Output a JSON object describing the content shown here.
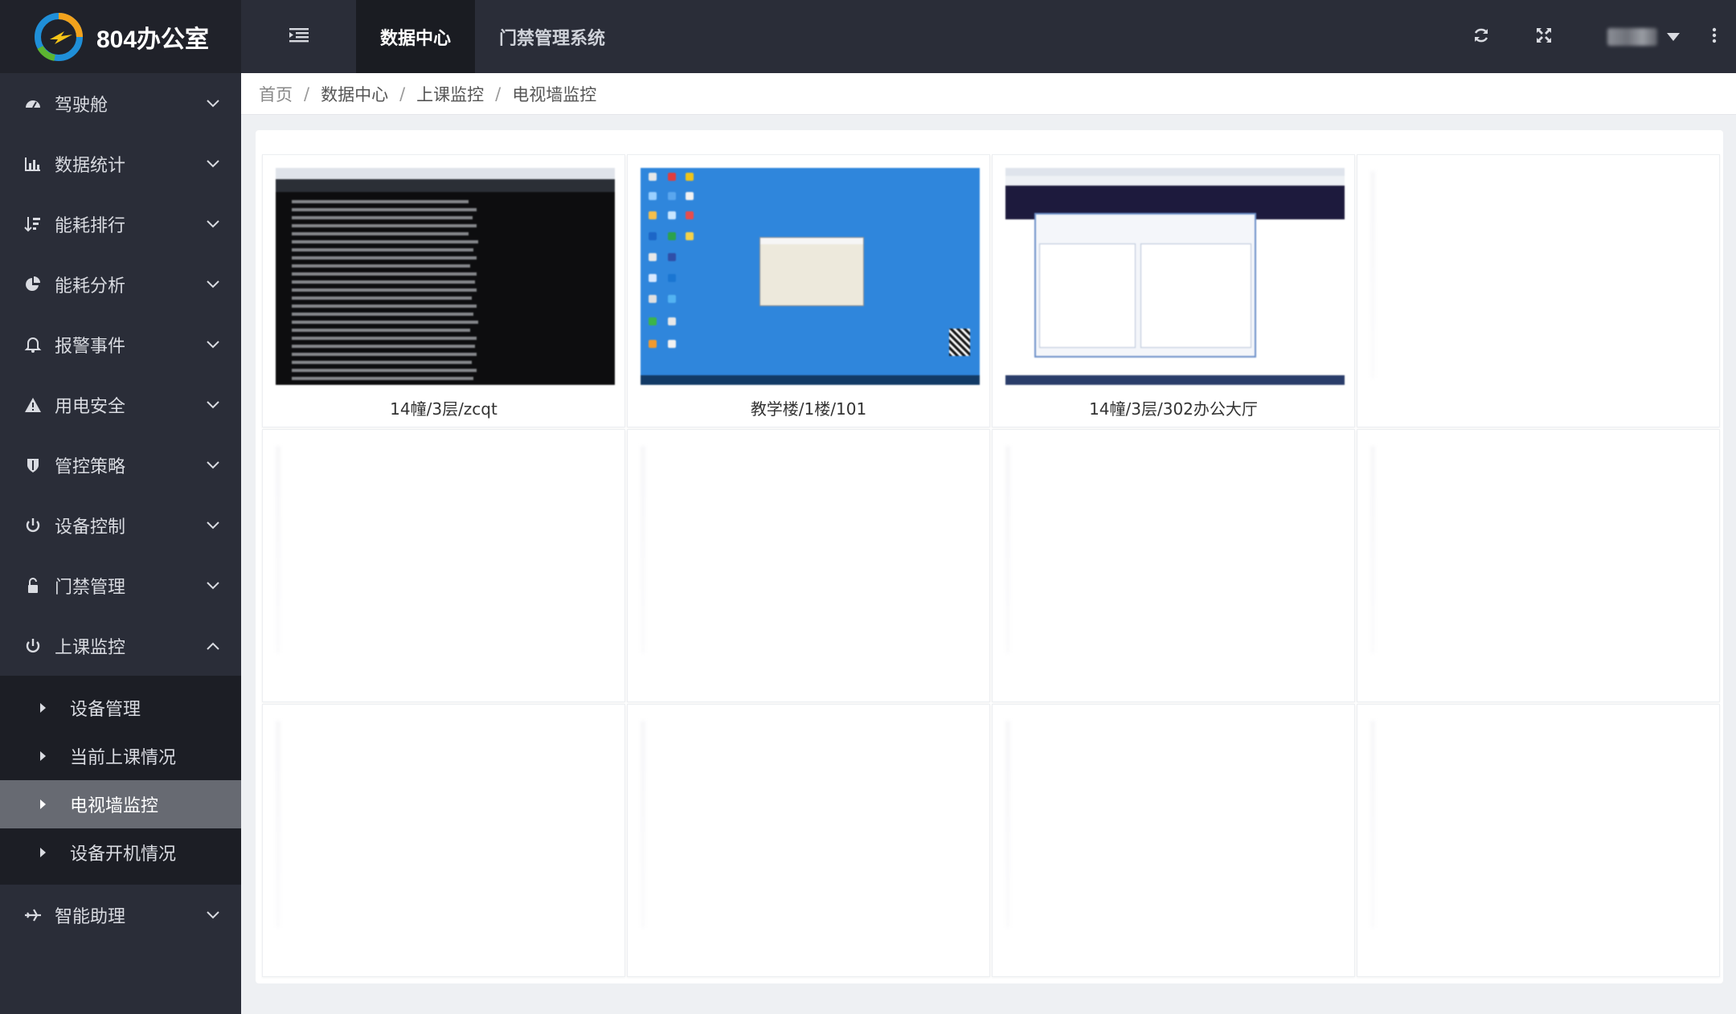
{
  "app": {
    "title": "804办公室"
  },
  "topbar": {
    "tabs": [
      {
        "label": "数据中心",
        "active": true
      },
      {
        "label": "门禁管理系统",
        "active": false
      }
    ]
  },
  "sidebar": {
    "items": [
      {
        "label": "驾驶舱",
        "icon": "dashboard-icon",
        "expanded": false
      },
      {
        "label": "数据统计",
        "icon": "bar-chart-icon",
        "expanded": false
      },
      {
        "label": "能耗排行",
        "icon": "sort-amount-icon",
        "expanded": false
      },
      {
        "label": "能耗分析",
        "icon": "pie-chart-icon",
        "expanded": false
      },
      {
        "label": "报警事件",
        "icon": "bell-icon",
        "expanded": false
      },
      {
        "label": "用电安全",
        "icon": "warning-icon",
        "expanded": false
      },
      {
        "label": "管控策略",
        "icon": "shield-icon",
        "expanded": false
      },
      {
        "label": "设备控制",
        "icon": "power-icon",
        "expanded": false
      },
      {
        "label": "门禁管理",
        "icon": "unlock-icon",
        "expanded": false
      },
      {
        "label": "上课监控",
        "icon": "power-icon",
        "expanded": true
      },
      {
        "label": "智能助理",
        "icon": "plane-icon",
        "expanded": false
      }
    ],
    "submenu": [
      {
        "label": "设备管理",
        "active": false
      },
      {
        "label": "当前上课情况",
        "active": false
      },
      {
        "label": "电视墙监控",
        "active": true
      },
      {
        "label": "设备开机情况",
        "active": false
      }
    ]
  },
  "breadcrumb": [
    "首页",
    "数据中心",
    "上课监控",
    "电视墙监控"
  ],
  "videowall": {
    "screens": [
      {
        "caption": "14幢/3层/zcqt"
      },
      {
        "caption": "教学楼/1楼/101"
      },
      {
        "caption": "14幢/3层/302办公大厅"
      }
    ]
  },
  "colors": {
    "sidebar_bg": "#2a2d38",
    "active_sub_bg": "#676a72",
    "content_bg": "#ffffff"
  }
}
